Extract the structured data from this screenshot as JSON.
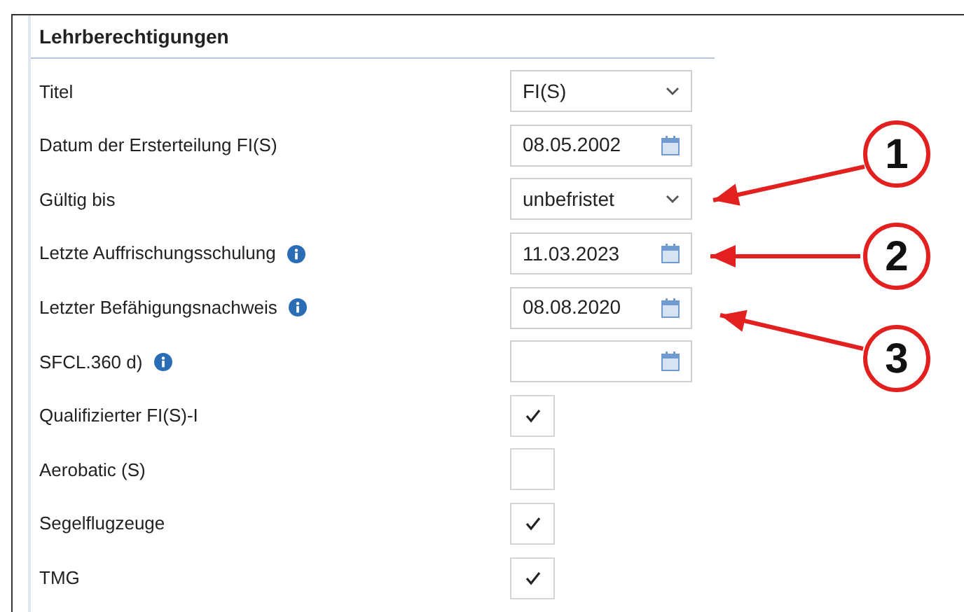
{
  "section": {
    "title": "Lehrberechtigungen"
  },
  "fields": [
    {
      "label": "Titel",
      "kind": "select",
      "value": "FI(S)",
      "info": false
    },
    {
      "label": "Datum der Ersterteilung FI(S)",
      "kind": "date",
      "value": "08.05.2002",
      "info": false
    },
    {
      "label": "Gültig bis",
      "kind": "select",
      "value": "unbefristet",
      "info": false
    },
    {
      "label": "Letzte Auffrischungsschulung",
      "kind": "date",
      "value": "11.03.2023",
      "info": true
    },
    {
      "label": "Letzter Befähigungsnachweis",
      "kind": "date",
      "value": "08.08.2020",
      "info": true
    },
    {
      "label": "SFCL.360 d)",
      "kind": "date",
      "info": true
    },
    {
      "label": "Qualifizierter FI(S)-I",
      "kind": "checkbox",
      "checked": true,
      "info": false
    },
    {
      "label": "Aerobatic (S)",
      "kind": "checkbox",
      "checked": false,
      "info": false
    },
    {
      "label": "Segelflugzeuge",
      "kind": "checkbox",
      "checked": true,
      "info": false
    },
    {
      "label": "TMG",
      "kind": "checkbox",
      "checked": true,
      "info": false
    }
  ],
  "callouts": [
    {
      "label": "1"
    },
    {
      "label": "2"
    },
    {
      "label": "3"
    }
  ]
}
